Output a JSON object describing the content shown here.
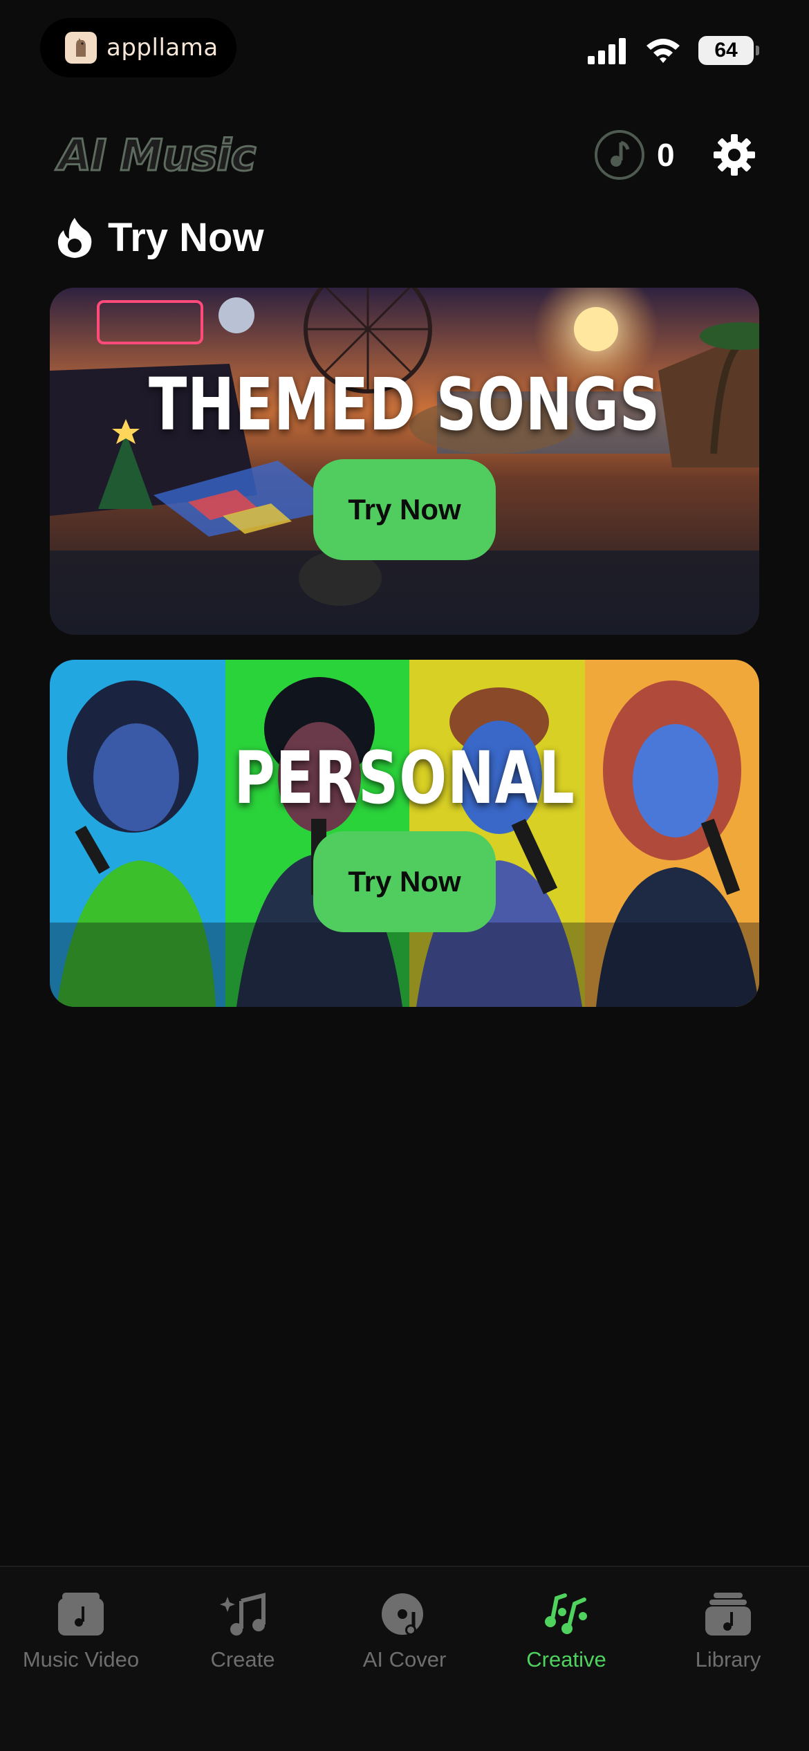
{
  "status_bar": {
    "app_badge": "appllama",
    "battery": "64",
    "icons": [
      "signal-icon",
      "wifi-icon",
      "battery-icon"
    ]
  },
  "header": {
    "title": "AI Music",
    "credits": "0",
    "icons": [
      "music-note-icon",
      "gear-icon"
    ]
  },
  "section": {
    "title": "Try Now",
    "icon": "flame-icon"
  },
  "cards": [
    {
      "title": "THEMED SONGS",
      "button": "Try Now"
    },
    {
      "title": "PERSONAL",
      "button": "Try Now"
    }
  ],
  "tab_bar": {
    "active_color": "#4fd25e",
    "inactive_color": "#6e6e6e",
    "items": [
      {
        "label": "Music Video",
        "icon": "music-video-icon",
        "active": false
      },
      {
        "label": "Create",
        "icon": "create-music-icon",
        "active": false
      },
      {
        "label": "AI Cover",
        "icon": "vinyl-icon",
        "active": false
      },
      {
        "label": "Creative",
        "icon": "creative-notes-icon",
        "active": true
      },
      {
        "label": "Library",
        "icon": "library-icon",
        "active": false
      }
    ]
  },
  "colors": {
    "background": "#0c0c0c",
    "accent": "#51cd5f"
  }
}
